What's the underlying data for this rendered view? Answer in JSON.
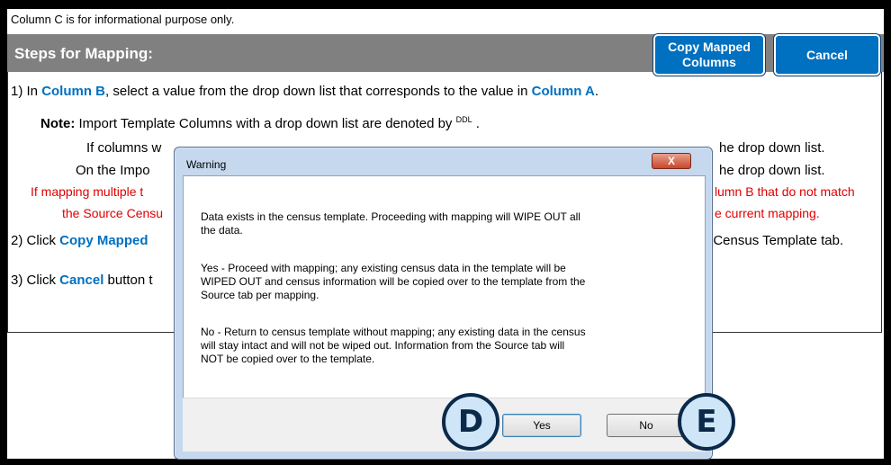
{
  "sheet": {
    "top_note": "Column C is for informational purpose only.",
    "steps_title": "Steps for Mapping:",
    "copy_button": "Copy Mapped\nColumns",
    "cancel_button": "Cancel",
    "step1_prefix": "1) In ",
    "step1_colB": "Column B",
    "step1_mid": ", select a value from the drop down list that corresponds to the value in ",
    "step1_colA": "Column A",
    "step1_end": ".",
    "note_label": "Note:",
    "note_text": " Import Template Columns with a drop down list are denoted by ",
    "note_sup": "DDL",
    "note_end": " .",
    "line_if_start": "If columns w",
    "line_if_end": "he drop down list.",
    "line_on_start": "On the Impo",
    "line_on_end": "he drop down list.",
    "red1_start": "If mapping multiple t",
    "red1_end": "lumn B that do not match",
    "red2_start": "the Source Censu",
    "red2_end": "e current mapping.",
    "step2_prefix": "2) Click ",
    "step2_link": "Copy Mapped",
    "step2_end": "rt Census Template tab.",
    "step3_prefix": "3) Click ",
    "step3_link": "Cancel",
    "step3_end": " button t"
  },
  "dialog": {
    "title": "Warning",
    "close": "X",
    "para1": "Data exists in the census template. Proceeding with mapping will WIPE OUT all\nthe data.",
    "para2": "Yes - Proceed with mapping; any existing census data in the template will be\nWIPED OUT and census information will be copied over to the template from the\nSource tab per mapping.",
    "para3": "No  - Return to census template without mapping; any existing data in the census\nwill stay intact and will not be wiped out. Information from the Source tab will\nNOT be copied over to the template.",
    "yes": "Yes",
    "no": "No"
  },
  "badges": {
    "d": "D",
    "e": "E"
  },
  "colors": {
    "accent_blue": "#0070c0",
    "warning_red": "#e00000",
    "bar_gray": "#808080"
  }
}
